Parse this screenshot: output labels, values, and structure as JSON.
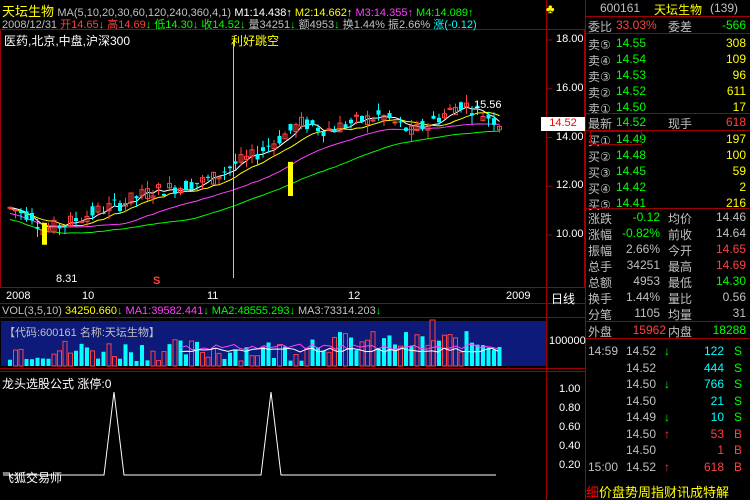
{
  "header": {
    "name": "天坛生物",
    "ma_spec": "MA(5,10,20,30,60,120,240,360,4,1)",
    "ma_values": [
      {
        "label": "M1:14.438",
        "color": "#ffffff"
      },
      {
        "label": "M2:14.662",
        "color": "#ffff00"
      },
      {
        "label": "M3:14.355",
        "color": "#ff40ff"
      },
      {
        "label": "M4:14.089",
        "color": "#00ff00"
      }
    ],
    "date": "2008/12/31",
    "open": "开14.65",
    "high": "高14.69",
    "low": "低14.30",
    "close": "收14.52",
    "volume": "量34251",
    "amount": "额4953",
    "turnover": "换1.44%",
    "amplitude": "振2.66%",
    "change": "涨(-0.12)"
  },
  "main_chart": {
    "tags": "医药,北京,中盘,沪深300",
    "annotation": "利好跳空",
    "high_label": "15.56",
    "low_label": "8.31",
    "current_price": "14.52",
    "s_marker": "S",
    "y_ticks": [
      "18.00",
      "16.00",
      "14.00",
      "12.00",
      "10.00"
    ],
    "x_labels": [
      "2008",
      "10",
      "11",
      "12",
      "2009"
    ],
    "period": "日线"
  },
  "volume_panel": {
    "spec": "VOL(3,5,10)",
    "vol": "34250.660",
    "ma1": "MA1:39582.441",
    "ma2": "MA2:48555.293",
    "ma3": "MA3:73314.203",
    "code_label": "【代码:600161 名称:天坛生物】",
    "tick": "100000"
  },
  "indicator_panel": {
    "title": "龙头选股公式",
    "value": "涨停:0",
    "footer": "飞狐交易师",
    "ticks": [
      "1.00",
      "0.80",
      "0.60",
      "0.40",
      "0.20"
    ]
  },
  "quote_panel": {
    "code": "600161",
    "name": "天坛生物",
    "count": "(139)",
    "ratio_label": "委比",
    "ratio": "33.03%",
    "diff_label": "委差",
    "diff": "-566",
    "sells": [
      {
        "label": "卖⑤",
        "price": "14.55",
        "vol": "308"
      },
      {
        "label": "卖④",
        "price": "14.54",
        "vol": "109"
      },
      {
        "label": "卖③",
        "price": "14.53",
        "vol": "96"
      },
      {
        "label": "卖②",
        "price": "14.52",
        "vol": "611"
      },
      {
        "label": "卖①",
        "price": "14.50",
        "vol": "17"
      }
    ],
    "latest_label": "最新",
    "latest": "14.52",
    "hand_label": "现手",
    "hand": "618",
    "buys": [
      {
        "label": "买①",
        "price": "14.49",
        "vol": "197"
      },
      {
        "label": "买②",
        "price": "14.48",
        "vol": "100"
      },
      {
        "label": "买③",
        "price": "14.45",
        "vol": "59"
      },
      {
        "label": "买④",
        "price": "14.42",
        "vol": "2"
      },
      {
        "label": "买⑤",
        "price": "14.41",
        "vol": "216"
      }
    ],
    "stats": [
      {
        "l1": "涨跌",
        "v1": "-0.12",
        "l2": "均价",
        "v2": "14.46",
        "c1": "#00ff00",
        "c2": "#c0c0c0"
      },
      {
        "l1": "涨幅",
        "v1": "-0.82%",
        "l2": "前收",
        "v2": "14.64",
        "c1": "#00ff00",
        "c2": "#c0c0c0"
      },
      {
        "l1": "振幅",
        "v1": "2.66%",
        "l2": "今开",
        "v2": "14.65",
        "c1": "#c0c0c0",
        "c2": "#ff4040"
      },
      {
        "l1": "总手",
        "v1": "34251",
        "l2": "最高",
        "v2": "14.69",
        "c1": "#c0c0c0",
        "c2": "#ff4040"
      },
      {
        "l1": "总额",
        "v1": "4953",
        "l2": "最低",
        "v2": "14.30",
        "c1": "#c0c0c0",
        "c2": "#00ff00"
      },
      {
        "l1": "换手",
        "v1": "1.44%",
        "l2": "量比",
        "v2": "0.56",
        "c1": "#c0c0c0",
        "c2": "#c0c0c0"
      },
      {
        "l1": "分笔",
        "v1": "1105",
        "l2": "均量",
        "v2": "31",
        "c1": "#c0c0c0",
        "c2": "#c0c0c0"
      }
    ],
    "outer_label": "外盘",
    "outer": "15962",
    "inner_label": "内盘",
    "inner": "18288",
    "ticks": [
      {
        "time": "14:59",
        "price": "14.52",
        "arrow": "↓",
        "vol": "122",
        "side": "S"
      },
      {
        "time": "",
        "price": "14.52",
        "arrow": "",
        "vol": "444",
        "side": "S"
      },
      {
        "time": "",
        "price": "14.50",
        "arrow": "↓",
        "vol": "766",
        "side": "S"
      },
      {
        "time": "",
        "price": "14.50",
        "arrow": "",
        "vol": "21",
        "side": "S"
      },
      {
        "time": "",
        "price": "14.49",
        "arrow": "↓",
        "vol": "10",
        "side": "S"
      },
      {
        "time": "",
        "price": "14.50",
        "arrow": "↑",
        "vol": "53",
        "side": "B"
      },
      {
        "time": "",
        "price": "14.50",
        "arrow": "",
        "vol": "1",
        "side": "B"
      },
      {
        "time": "15:00",
        "price": "14.52",
        "arrow": "↑",
        "vol": "618",
        "side": "B"
      }
    ],
    "ticker": "价盘势周指财讯成特解",
    "ticker_first": "细"
  },
  "colors": {
    "up": "#ff4040",
    "down": "#00ffff",
    "green": "#00ff00",
    "yellow": "#ffff00",
    "axis": "#a00000"
  }
}
